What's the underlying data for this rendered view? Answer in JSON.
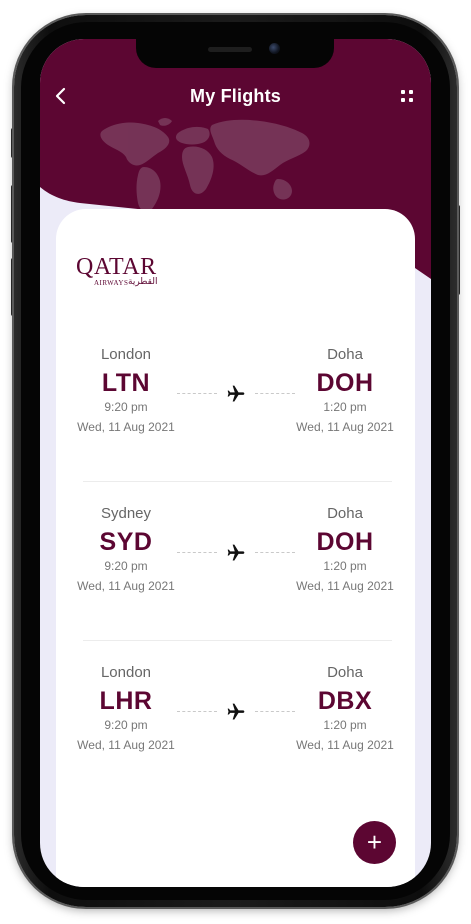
{
  "header": {
    "title": "My Flights",
    "back_icon": "chevron-left-icon",
    "menu_icon": "grid-dots-icon"
  },
  "airline": {
    "name": "QATAR",
    "subtitle": "AIRWAYS",
    "arabic": "القطرية"
  },
  "flights": [
    {
      "from_city": "London",
      "from_code": "LTN",
      "from_time": "9:20 pm",
      "from_date": "Wed, 11 Aug 2021",
      "to_city": "Doha",
      "to_code": "DOH",
      "to_time": "1:20 pm",
      "to_date": "Wed, 11 Aug 2021"
    },
    {
      "from_city": "Sydney",
      "from_code": "SYD",
      "from_time": "9:20 pm",
      "from_date": "Wed, 11 Aug 2021",
      "to_city": "Doha",
      "to_code": "DOH",
      "to_time": "1:20 pm",
      "to_date": "Wed, 11 Aug 2021"
    },
    {
      "from_city": "London",
      "from_code": "LHR",
      "from_time": "9:20 pm",
      "from_date": "Wed, 11 Aug 2021",
      "to_city": "Doha",
      "to_code": "DBX",
      "to_time": "1:20 pm",
      "to_date": "Wed, 11 Aug 2021"
    }
  ],
  "fab": {
    "label": "+",
    "icon": "plus-icon"
  },
  "colors": {
    "brand": "#5c0632",
    "background": "#ecebf8",
    "card": "#ffffff"
  }
}
